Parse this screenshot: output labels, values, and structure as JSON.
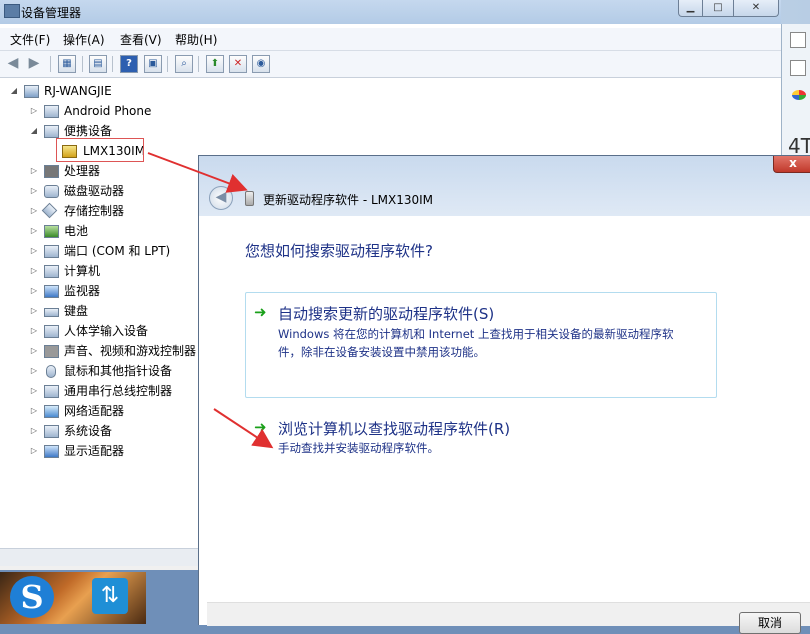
{
  "device_manager": {
    "title": "设备管理器",
    "caption_buttons": {
      "minimize": "▁",
      "maximize": "□",
      "close": "✕"
    },
    "menu": [
      "文件(F)",
      "操作(A)",
      "查看(V)",
      "帮助(H)"
    ],
    "tree": {
      "root": "RJ-WANGJIE",
      "items": [
        {
          "label": "Android Phone"
        },
        {
          "label": "便携设备"
        },
        {
          "label": "LMX130IM"
        },
        {
          "label": "处理器"
        },
        {
          "label": "磁盘驱动器"
        },
        {
          "label": "存储控制器"
        },
        {
          "label": "电池"
        },
        {
          "label": "端口 (COM 和 LPT)"
        },
        {
          "label": "计算机"
        },
        {
          "label": "监视器"
        },
        {
          "label": "键盘"
        },
        {
          "label": "人体学输入设备"
        },
        {
          "label": "声音、视频和游戏控制器"
        },
        {
          "label": "鼠标和其他指针设备"
        },
        {
          "label": "通用串行总线控制器"
        },
        {
          "label": "网络适配器"
        },
        {
          "label": "系统设备"
        },
        {
          "label": "显示适配器"
        }
      ]
    }
  },
  "wizard": {
    "close_label": "x",
    "header_title": "更新驱动程序软件 - LMX130IM",
    "question": "您想如何搜索驱动程序软件?",
    "options": [
      {
        "title": "自动搜索更新的驱动程序软件(S)",
        "desc_line1": "Windows 将在您的计算机和 Internet 上查找用于相关设备的最新驱动程序软",
        "desc_line2": "件，除非在设备安装设置中禁用该功能。"
      },
      {
        "title": "浏览计算机以查找驱动程序软件(R)",
        "desc_line1": "手动查找并安装驱动程序软件。"
      }
    ],
    "cancel_label": "取消"
  },
  "colors": {
    "link_blue": "#1e3287",
    "arrow_green": "#1aa01a",
    "annotation_red": "#e03030"
  }
}
